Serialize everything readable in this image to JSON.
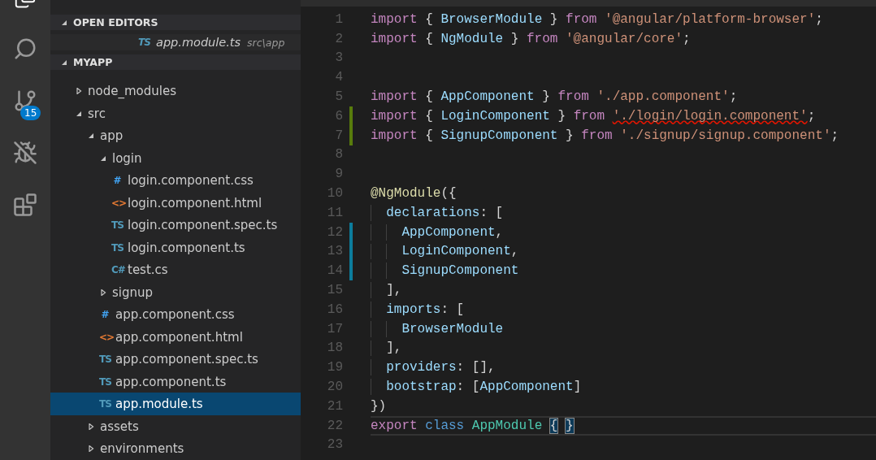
{
  "activity_bar": {
    "source_control_badge": "15"
  },
  "open_editors": {
    "title": "OPEN EDITORS",
    "expanded": true,
    "items": [
      {
        "icon": "TS",
        "kind": "ts",
        "name": "app.module.ts",
        "path": "src\\app"
      }
    ]
  },
  "project": {
    "title": "MYAPP",
    "expanded": true,
    "tree": [
      {
        "name": "node_modules",
        "kind": "folder",
        "expanded": false,
        "selected": false
      },
      {
        "name": "src",
        "kind": "folder",
        "expanded": true,
        "selected": false,
        "children": [
          {
            "name": "app",
            "kind": "folder",
            "expanded": true,
            "selected": false,
            "children": [
              {
                "name": "login",
                "kind": "folder",
                "expanded": true,
                "selected": false,
                "children": [
                  {
                    "name": "login.component.css",
                    "kind": "css",
                    "icon": "#",
                    "selected": false
                  },
                  {
                    "name": "login.component.html",
                    "kind": "html",
                    "icon": "<>",
                    "selected": false
                  },
                  {
                    "name": "login.component.spec.ts",
                    "kind": "ts",
                    "icon": "TS",
                    "selected": false
                  },
                  {
                    "name": "login.component.ts",
                    "kind": "ts",
                    "icon": "TS",
                    "selected": false
                  },
                  {
                    "name": "test.cs",
                    "kind": "cs",
                    "icon": "C#",
                    "selected": false
                  }
                ]
              },
              {
                "name": "signup",
                "kind": "folder",
                "expanded": false,
                "selected": false
              },
              {
                "name": "app.component.css",
                "kind": "css",
                "icon": "#",
                "selected": false
              },
              {
                "name": "app.component.html",
                "kind": "html",
                "icon": "<>",
                "selected": false
              },
              {
                "name": "app.component.spec.ts",
                "kind": "ts",
                "icon": "TS",
                "selected": false
              },
              {
                "name": "app.component.ts",
                "kind": "ts",
                "icon": "TS",
                "selected": false
              },
              {
                "name": "app.module.ts",
                "kind": "ts",
                "icon": "TS",
                "selected": true
              }
            ]
          },
          {
            "name": "assets",
            "kind": "folder",
            "expanded": false,
            "selected": false
          },
          {
            "name": "environments",
            "kind": "folder",
            "expanded": false,
            "selected": false
          }
        ]
      }
    ]
  },
  "editor": {
    "lines": [
      {
        "number": "1",
        "kind": "top",
        "added": false,
        "modified": false,
        "current": false,
        "tokens": [
          {
            "kind": "keyword",
            "text": "import"
          },
          {
            "kind": "punct",
            "text": "{"
          },
          {
            "kind": "ident",
            "text": "BrowserModule"
          },
          {
            "kind": "punct",
            "text": "}"
          },
          {
            "kind": "keyword",
            "text": "from"
          },
          {
            "kind": "string",
            "text": "'@angular/platform-browser'"
          },
          {
            "kind": "end",
            "text": ";"
          }
        ]
      },
      {
        "number": "2",
        "kind": "top",
        "added": false,
        "modified": false,
        "current": false,
        "tokens": [
          {
            "kind": "keyword",
            "text": "import"
          },
          {
            "kind": "punct",
            "text": "{"
          },
          {
            "kind": "ident",
            "text": "NgModule"
          },
          {
            "kind": "punct",
            "text": "}"
          },
          {
            "kind": "keyword",
            "text": "from"
          },
          {
            "kind": "string",
            "text": "'@angular/core'"
          },
          {
            "kind": "end",
            "text": ";"
          }
        ]
      },
      {
        "number": "3",
        "kind": "top",
        "added": false,
        "modified": false,
        "current": false
      },
      {
        "number": "4",
        "kind": "top",
        "added": false,
        "modified": false,
        "current": false
      },
      {
        "number": "5",
        "kind": "top",
        "added": false,
        "modified": false,
        "current": false,
        "tokens": [
          {
            "kind": "keyword",
            "text": "import"
          },
          {
            "kind": "punct",
            "text": "{"
          },
          {
            "kind": "ident",
            "text": "AppComponent"
          },
          {
            "kind": "punct",
            "text": "}"
          },
          {
            "kind": "keyword",
            "text": "from"
          },
          {
            "kind": "string",
            "text": "'./app.component'"
          },
          {
            "kind": "end",
            "text": ";"
          }
        ]
      },
      {
        "number": "6",
        "kind": "top",
        "added": true,
        "modified": false,
        "current": false,
        "tokens": [
          {
            "kind": "keyword",
            "text": "import"
          },
          {
            "kind": "punct",
            "text": "{"
          },
          {
            "kind": "ident",
            "text": "LoginComponent"
          },
          {
            "kind": "punct",
            "text": "}"
          },
          {
            "kind": "keyword",
            "text": "from"
          },
          {
            "kind": "string-error",
            "text": "'./login/login.component'"
          },
          {
            "kind": "end",
            "text": ";"
          }
        ]
      },
      {
        "number": "7",
        "kind": "top",
        "added": true,
        "modified": false,
        "current": false,
        "tokens": [
          {
            "kind": "keyword",
            "text": "import"
          },
          {
            "kind": "punct",
            "text": "{"
          },
          {
            "kind": "ident",
            "text": "SignupComponent"
          },
          {
            "kind": "punct",
            "text": "}"
          },
          {
            "kind": "keyword",
            "text": "from"
          },
          {
            "kind": "string",
            "text": "'./signup/signup.component'"
          },
          {
            "kind": "end",
            "text": ";"
          }
        ]
      },
      {
        "number": "8",
        "kind": "top",
        "added": false,
        "modified": false,
        "current": false
      },
      {
        "number": "9",
        "kind": "top",
        "added": false,
        "modified": false,
        "current": false
      },
      {
        "number": "10",
        "kind": "top",
        "added": false,
        "modified": false,
        "current": false,
        "tokens": [
          {
            "kind": "decorator",
            "text": "@NgModule"
          },
          {
            "kind": "end",
            "text": "({"
          }
        ]
      },
      {
        "number": "11",
        "kind": "inner",
        "added": false,
        "modified": false,
        "current": false,
        "tokens": [
          {
            "kind": "ident",
            "text": "declarations"
          },
          {
            "kind": "end",
            "text": ":"
          },
          {
            "kind": "punct",
            "text": "["
          }
        ]
      },
      {
        "number": "12",
        "kind": "deep",
        "added": false,
        "modified": true,
        "current": false,
        "tokens": [
          {
            "kind": "ident",
            "text": "AppComponent"
          },
          {
            "kind": "end",
            "text": ","
          }
        ]
      },
      {
        "number": "13",
        "kind": "deep",
        "added": false,
        "modified": true,
        "current": false,
        "tokens": [
          {
            "kind": "ident",
            "text": "LoginComponent"
          },
          {
            "kind": "end",
            "text": ","
          }
        ]
      },
      {
        "number": "14",
        "kind": "deep",
        "added": false,
        "modified": true,
        "current": false,
        "tokens": [
          {
            "kind": "ident",
            "text": "SignupComponent"
          }
        ]
      },
      {
        "number": "15",
        "kind": "inner",
        "added": false,
        "modified": false,
        "current": false,
        "tokens": [
          {
            "kind": "end",
            "text": "],"
          }
        ]
      },
      {
        "number": "16",
        "kind": "inner",
        "added": false,
        "modified": false,
        "current": false,
        "tokens": [
          {
            "kind": "ident",
            "text": "imports"
          },
          {
            "kind": "end",
            "text": ":"
          },
          {
            "kind": "punct",
            "text": "["
          }
        ]
      },
      {
        "number": "17",
        "kind": "deep",
        "added": false,
        "modified": false,
        "current": false,
        "tokens": [
          {
            "kind": "ident",
            "text": "BrowserModule"
          }
        ]
      },
      {
        "number": "18",
        "kind": "inner",
        "added": false,
        "modified": false,
        "current": false,
        "tokens": [
          {
            "kind": "end",
            "text": "],"
          }
        ]
      },
      {
        "number": "19",
        "kind": "inner",
        "added": false,
        "modified": false,
        "current": false,
        "tokens": [
          {
            "kind": "ident",
            "text": "providers"
          },
          {
            "kind": "end",
            "text": ":"
          },
          {
            "kind": "punct",
            "text": "[],"
          }
        ]
      },
      {
        "number": "20",
        "kind": "inner",
        "added": false,
        "modified": false,
        "current": false,
        "tokens": [
          {
            "kind": "ident",
            "text": "bootstrap"
          },
          {
            "kind": "end",
            "text": ":"
          },
          {
            "kind": "punct",
            "text": "["
          },
          {
            "kind": "ident-tight",
            "text": "AppComponent"
          },
          {
            "kind": "end",
            "text": "]"
          }
        ]
      },
      {
        "number": "21",
        "kind": "top",
        "added": false,
        "modified": false,
        "current": false,
        "tokens": [
          {
            "kind": "end",
            "text": "})"
          }
        ]
      },
      {
        "number": "22",
        "kind": "top",
        "added": false,
        "modified": false,
        "current": true,
        "tokens": [
          {
            "kind": "keyword",
            "text": "export"
          },
          {
            "kind": "storage",
            "text": "class"
          },
          {
            "kind": "type",
            "text": "AppModule"
          },
          {
            "kind": "bracket-match",
            "text": "{"
          },
          {
            "kind": "bracket-match",
            "text": "}"
          }
        ]
      },
      {
        "number": "23",
        "kind": "top",
        "added": false,
        "modified": false,
        "current": false
      }
    ]
  }
}
